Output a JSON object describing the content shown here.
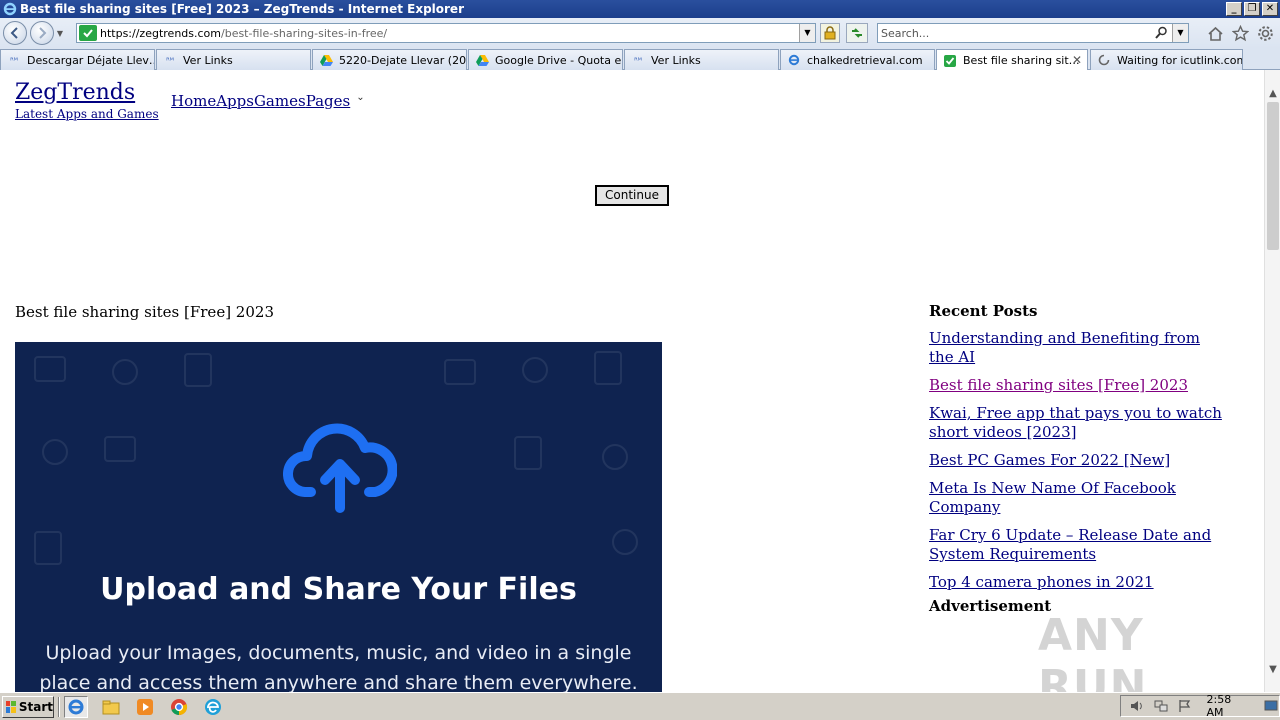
{
  "window": {
    "title": "Best file sharing sites [Free] 2023 – ZegTrends - Internet Explorer",
    "buttons": [
      "minimize",
      "restore",
      "close"
    ]
  },
  "address_bar": {
    "url_host": "https://zegtrends.com",
    "url_path": "/best-file-sharing-sites-in-free/"
  },
  "search": {
    "placeholder": "Search..."
  },
  "tabs": [
    {
      "label": "Descargar Déjate Llev…",
      "icon": "rm-icon"
    },
    {
      "label": "Ver Links",
      "icon": "rm-icon"
    },
    {
      "label": "5220-Dejate Llevar (20…",
      "icon": "google-drive-icon"
    },
    {
      "label": "Google Drive - Quota e…",
      "icon": "google-drive-icon"
    },
    {
      "label": "Ver Links",
      "icon": "rm-icon"
    },
    {
      "label": "chalkedretrieval.com",
      "icon": "ie-icon"
    },
    {
      "label": "Best file sharing sit…",
      "icon": "shield-icon",
      "active": true
    },
    {
      "label": "Waiting for icutlink.com",
      "icon": "loading-icon"
    }
  ],
  "site": {
    "title": "ZegTrends",
    "tagline": "Latest Apps and Games",
    "nav": [
      "Home",
      "Apps",
      "Games",
      "Pages"
    ]
  },
  "continue_label": "Continue",
  "post": {
    "heading": "Best file sharing sites [Free] 2023"
  },
  "hero": {
    "title": "Upload and Share Your Files",
    "subtitle": "Upload your Images, documents, music, and video in a single place and access them anywhere and share them everywhere."
  },
  "sidebar": {
    "recent_heading": "Recent Posts",
    "recent_posts": [
      "Understanding and Benefiting from the AI",
      "Best file sharing sites [Free] 2023",
      "Kwai, Free app that pays you to watch short videos [2023]",
      "Best PC Games For 2022 [New]",
      "Meta Is New Name Of Facebook Company",
      "Far Cry 6 Update – Release Date and System Requirements",
      "Top 4 camera phones in 2021"
    ],
    "advert_heading": "Advertisement"
  },
  "watermark": "ANY RUN",
  "taskbar": {
    "start_label": "Start",
    "clock": "2:58 AM"
  },
  "colors": {
    "link": "#000080",
    "visited": "#800080",
    "hero_bg": "#0f2350",
    "cloud": "#1e6ff2"
  }
}
